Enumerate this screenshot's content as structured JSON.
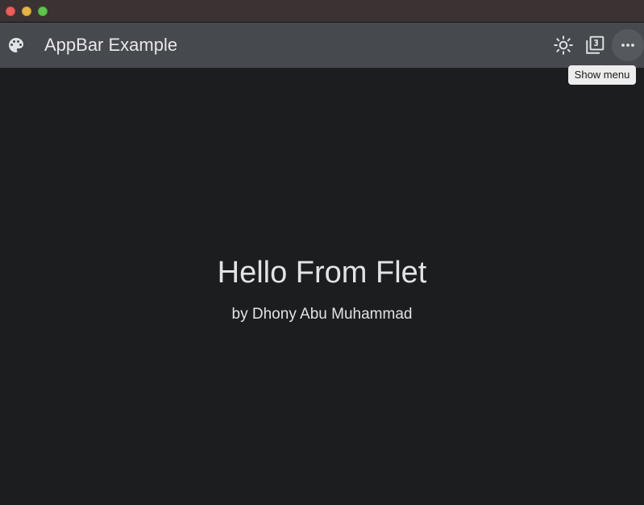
{
  "window": {
    "controls": {
      "close_color": "#ec5f5c",
      "minimize_color": "#e3b448",
      "zoom_color": "#5fc54d"
    }
  },
  "appbar": {
    "title": "AppBar Example",
    "leading_icon": "palette-icon",
    "background": "#46494d",
    "actions": [
      {
        "icon": "brightness-icon"
      },
      {
        "icon": "filter-3-icon"
      },
      {
        "icon": "more-horiz-icon",
        "tooltip": "Show menu"
      }
    ]
  },
  "main": {
    "heading": "Hello From Flet",
    "byline": "by Dhony Abu Muhammad",
    "background": "#1c1d1f"
  }
}
